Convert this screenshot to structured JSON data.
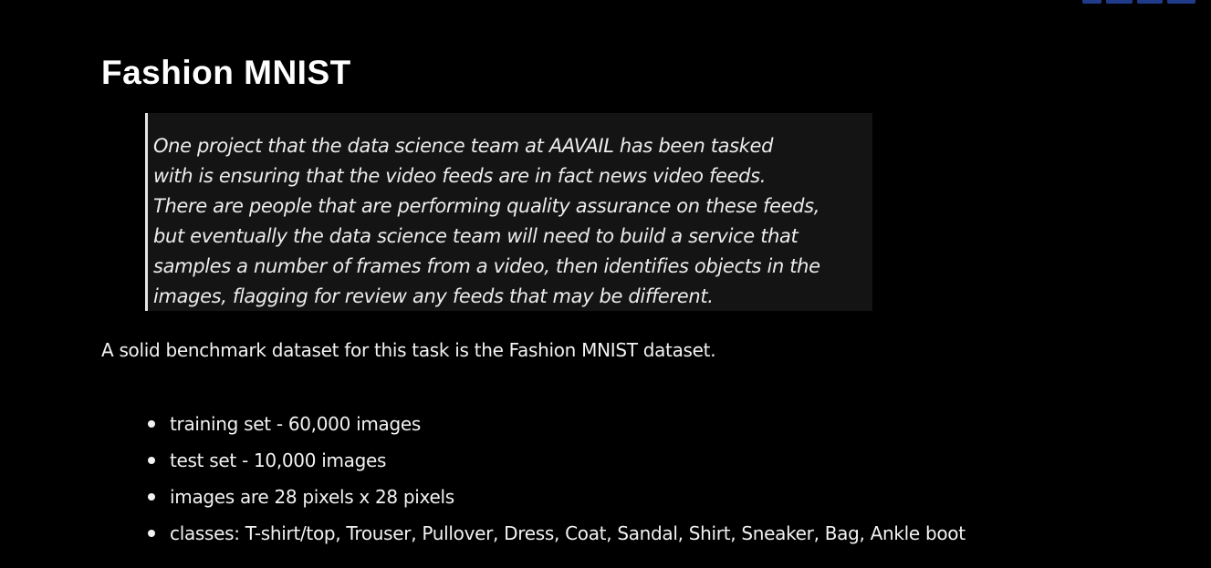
{
  "logo": {
    "icon": "ibm-logo-icon"
  },
  "title": "Fashion MNIST",
  "quote": {
    "lines": [
      "One project that the data science team at AAVAIL has been tasked",
      "with is ensuring that the video feeds are in fact news video feeds.",
      "There are people that are performing quality assurance on these feeds,",
      "but eventually the data science team will need to build a service that",
      "samples a number of frames from a video, then identifies objects in the",
      "images, flagging for review any feeds that may be different."
    ]
  },
  "intro": "A solid benchmark dataset for this task is the Fashion MNIST dataset.",
  "bullets": [
    "training set - 60,000 images",
    "test set - 10,000 images",
    "images are 28 pixels x 28 pixels",
    "classes: T-shirt/top, Trouser, Pullover, Dress, Coat, Sandal, Shirt, Sneaker, Bag, Ankle boot"
  ],
  "colors": {
    "background": "#000000",
    "text": "#ffffff",
    "quote_background": "#141414",
    "quote_border": "#e6e6e6",
    "logo": "#1f3b8a"
  }
}
